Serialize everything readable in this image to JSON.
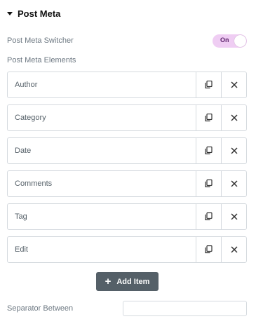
{
  "section": {
    "title": "Post Meta",
    "caret_icon": "caret-down-icon"
  },
  "switcher": {
    "label": "Post Meta Switcher",
    "state": "On",
    "accent": "#efcdf3"
  },
  "elements": {
    "label": "Post Meta Elements",
    "items": [
      {
        "label": "Author"
      },
      {
        "label": "Category"
      },
      {
        "label": "Date"
      },
      {
        "label": "Comments"
      },
      {
        "label": "Tag"
      },
      {
        "label": "Edit"
      }
    ],
    "duplicate_icon": "duplicate-icon",
    "remove_icon": "close-icon"
  },
  "add_button": {
    "label": "Add Item",
    "icon": "plus-icon",
    "color": "#556068"
  },
  "separator": {
    "label": "Separator Between",
    "value": "",
    "placeholder": ""
  }
}
